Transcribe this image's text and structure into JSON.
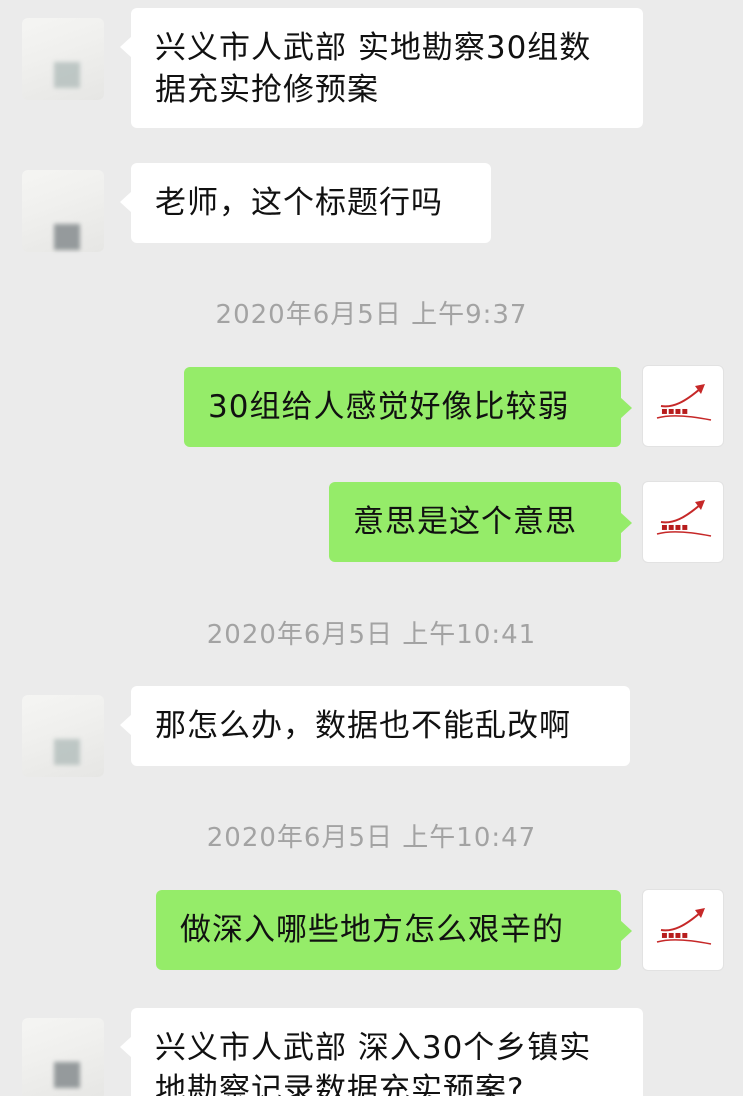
{
  "colors": {
    "background": "#ebebeb",
    "incoming_bubble": "#ffffff",
    "outgoing_bubble": "#95ec69",
    "timestamp_text": "#a3a3a3"
  },
  "messages": [
    {
      "type": "incoming",
      "avatar": "blurred-avatar",
      "lines": [
        "兴义市人武部 实地勘察30组数",
        "据充实抢修预案"
      ]
    },
    {
      "type": "incoming",
      "avatar": "blurred-avatar",
      "lines": [
        "老师，这个标题行吗"
      ]
    },
    {
      "type": "timestamp",
      "text": "2020年6月5日 上午9:37"
    },
    {
      "type": "outgoing",
      "avatar": "signature-logo-avatar",
      "lines": [
        "30组给人感觉好像比较弱"
      ]
    },
    {
      "type": "outgoing",
      "avatar": "signature-logo-avatar",
      "lines": [
        "意思是这个意思"
      ]
    },
    {
      "type": "timestamp",
      "text": "2020年6月5日 上午10:41"
    },
    {
      "type": "incoming",
      "avatar": "blurred-avatar",
      "lines": [
        "那怎么办，数据也不能乱改啊"
      ]
    },
    {
      "type": "timestamp",
      "text": "2020年6月5日 上午10:47"
    },
    {
      "type": "outgoing",
      "avatar": "signature-logo-avatar",
      "lines": [
        "做深入哪些地方怎么艰辛的"
      ]
    },
    {
      "type": "incoming",
      "avatar": "blurred-avatar",
      "lines": [
        "兴义市人武部 深入30个乡镇实",
        "地勘察记录数据充实预案?"
      ]
    }
  ]
}
